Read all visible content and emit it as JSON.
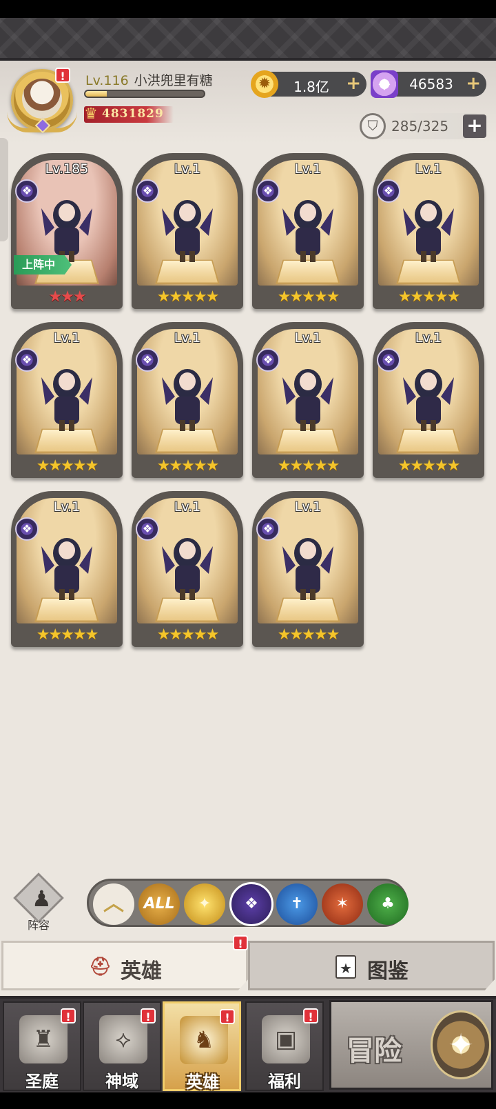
{
  "player": {
    "level_prefix": "Lv.116",
    "name": "小洪兜里有糖",
    "exp_fraction": 0.18,
    "power": "4831829",
    "avatar_alert": "!"
  },
  "currencies": {
    "gold": {
      "icon": "gold-coin-icon",
      "value": "1.8亿",
      "plus": "+"
    },
    "gems": {
      "icon": "diamond-icon",
      "value": "46583",
      "plus": "+"
    }
  },
  "capacity": {
    "icon": "shield-icon",
    "value": "285/325",
    "plus": "+"
  },
  "heroes": [
    {
      "level": "Lv.185",
      "stars": "★★★",
      "star_color": "red",
      "deployed": true,
      "deploy_label": "上阵中",
      "faction": "dark"
    },
    {
      "level": "Lv.1",
      "stars": "★★★★★",
      "star_color": "gold",
      "deployed": false,
      "faction": "dark"
    },
    {
      "level": "Lv.1",
      "stars": "★★★★★",
      "star_color": "gold",
      "deployed": false,
      "faction": "dark"
    },
    {
      "level": "Lv.1",
      "stars": "★★★★★",
      "star_color": "gold",
      "deployed": false,
      "faction": "dark"
    },
    {
      "level": "Lv.1",
      "stars": "★★★★★",
      "star_color": "gold",
      "deployed": false,
      "faction": "dark"
    },
    {
      "level": "Lv.1",
      "stars": "★★★★★",
      "star_color": "gold",
      "deployed": false,
      "faction": "dark"
    },
    {
      "level": "Lv.1",
      "stars": "★★★★★",
      "star_color": "gold",
      "deployed": false,
      "faction": "dark"
    },
    {
      "level": "Lv.1",
      "stars": "★★★★★",
      "star_color": "gold",
      "deployed": false,
      "faction": "dark"
    },
    {
      "level": "Lv.1",
      "stars": "★★★★★",
      "star_color": "gold",
      "deployed": false,
      "faction": "dark"
    },
    {
      "level": "Lv.1",
      "stars": "★★★★★",
      "star_color": "gold",
      "deployed": false,
      "faction": "dark"
    },
    {
      "level": "Lv.1",
      "stars": "★★★★★",
      "star_color": "gold",
      "deployed": false,
      "faction": "dark"
    }
  ],
  "lineup": {
    "label": "阵容"
  },
  "filters": {
    "all_label": "ALL",
    "selected": "dark"
  },
  "tabs": {
    "heroes": "英雄",
    "gallery": "图鉴",
    "alert": "!"
  },
  "nav": {
    "items": [
      {
        "label": "圣庭",
        "alert": "!"
      },
      {
        "label": "神域",
        "alert": "!"
      },
      {
        "label": "英雄",
        "alert": "!"
      },
      {
        "label": "福利",
        "alert": "!"
      }
    ],
    "adventure": "冒险"
  },
  "colors": {
    "accent_gold": "#f4c52b",
    "alert_red": "#e0323a",
    "deploy_green": "#2a9b57",
    "dark_faction": "#5c3fa8"
  }
}
